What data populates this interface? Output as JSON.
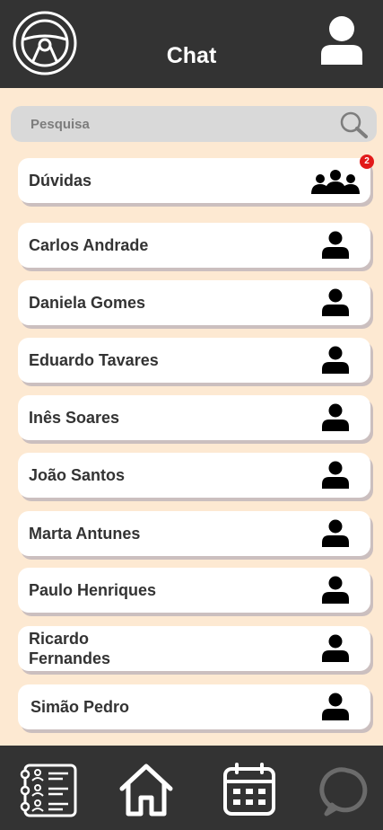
{
  "header": {
    "title": "Chat",
    "logo_icon": "steering-wheel-icon",
    "profile_icon": "user-icon"
  },
  "search": {
    "placeholder": "Pesquisa",
    "value": "",
    "icon": "search-icon"
  },
  "group_chat": {
    "label": "Dúvidas",
    "icon": "group-icon",
    "badge": "2"
  },
  "contacts": [
    {
      "name": "Carlos Andrade"
    },
    {
      "name": "Daniela Gomes"
    },
    {
      "name": "Eduardo Tavares"
    },
    {
      "name": "Inês Soares"
    },
    {
      "name": "João Santos"
    },
    {
      "name": "Marta Antunes"
    },
    {
      "name": "Paulo Henriques"
    },
    {
      "name": "Ricardo Fernandes"
    },
    {
      "name": "Simão Pedro"
    }
  ],
  "nav": {
    "items": [
      "contacts-list-icon",
      "home-icon",
      "calendar-icon",
      "chat-icon"
    ],
    "active": "chat-icon"
  },
  "colors": {
    "header_bg": "#333333",
    "page_bg": "#fde9d2",
    "card_bg": "#ffffff",
    "search_bg": "#d9d9d9",
    "badge": "#e21a1a",
    "nav_inactive": "#6b6b6b"
  }
}
